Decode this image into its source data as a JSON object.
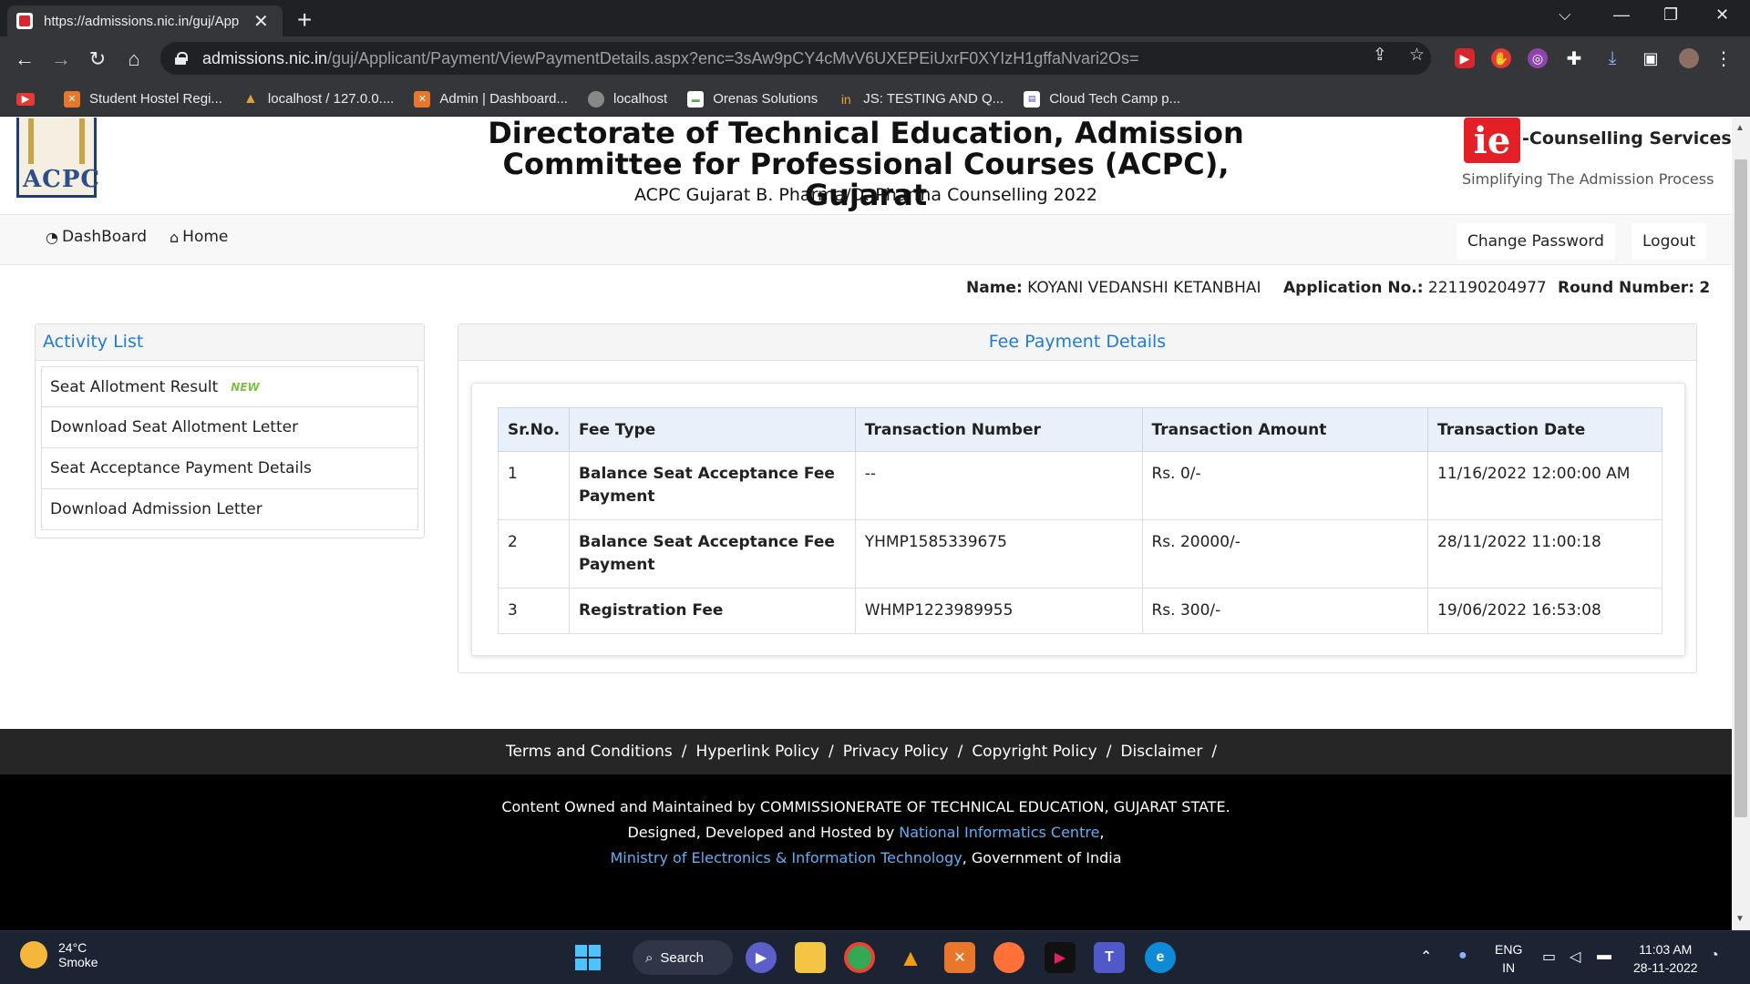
{
  "browser": {
    "tab_title": "https://admissions.nic.in/guj/App",
    "url_host": "admissions.nic.in",
    "url_path": "/guj/Applicant/Payment/ViewPaymentDetails.aspx?enc=3sAw9pCY4cMvV6UXEPEiUxrF0XYIzH1gffaNvari2Os=",
    "bookmarks": [
      {
        "label": "Student Hostel Regi...",
        "color": "#e8762b"
      },
      {
        "label": "localhost / 127.0.0....",
        "color": "#e0a040"
      },
      {
        "label": "Admin | Dashboard...",
        "color": "#e8762b"
      },
      {
        "label": "localhost",
        "color": "#888888"
      },
      {
        "label": "Orenas Solutions",
        "color": "#4caf50"
      },
      {
        "label": "JS: TESTING AND Q...",
        "color": "#f0a030"
      },
      {
        "label": "Cloud Tech Camp p...",
        "color": "#3f51b5"
      }
    ]
  },
  "header": {
    "logo_text": "ACPC",
    "title_line1": "Directorate of Technical Education, Admission",
    "title_line2": "Committee for Professional Courses (ACPC), Gujarat",
    "subtitle": "ACPC Gujarat B. Pharma/D. Pharma Counselling 2022",
    "brand_icon": "ie",
    "brand_name": "-Counselling Services",
    "brand_tagline": "Simplifying The Admission Process"
  },
  "navbar": {
    "dashboard": "DashBoard",
    "home": "Home",
    "change_password": "Change Password",
    "logout": "Logout"
  },
  "user": {
    "name_label": "Name:",
    "name_value": "KOYANI VEDANSHI KETANBHAI",
    "app_label": "Application No.:",
    "app_value": "221190204977",
    "round_label": "Round Number:",
    "round_value": "2"
  },
  "activity": {
    "title": "Activity List",
    "new_badge": "NEW",
    "items": [
      "Seat Allotment Result",
      "Download Seat Allotment Letter",
      "Seat Acceptance Payment Details",
      "Download Admission Letter"
    ]
  },
  "fee": {
    "title": "Fee Payment Details",
    "columns": [
      "Sr.No.",
      "Fee Type",
      "Transaction Number",
      "Transaction Amount",
      "Transaction Date"
    ],
    "rows": [
      [
        "1",
        "Balance Seat Acceptance Fee Payment",
        "--",
        "Rs. 0/-",
        "11/16/2022 12:00:00 AM"
      ],
      [
        "2",
        "Balance Seat Acceptance Fee Payment",
        "YHMP1585339675",
        "Rs. 20000/-",
        "28/11/2022 11:00:18"
      ],
      [
        "3",
        "Registration Fee",
        "WHMP1223989955",
        "Rs. 300/-",
        "19/06/2022 16:53:08"
      ]
    ]
  },
  "footer": {
    "links": [
      "Terms and Conditions",
      "Hyperlink Policy",
      "Privacy Policy",
      "Copyright Policy",
      "Disclaimer"
    ],
    "separator": "/",
    "line1": "Content Owned and Maintained by COMMISSIONERATE OF TECHNICAL EDUCATION, GUJARAT STATE.",
    "line2_prefix": "Designed, Developed and Hosted by ",
    "line2_link": "National Informatics Centre",
    "line2_suffix": ",",
    "line3_link": "Ministry of Electronics & Information Technology",
    "line3_suffix": ", Government of India"
  },
  "taskbar": {
    "temperature": "24°C",
    "weather": "Smoke",
    "search": "Search",
    "lang1": "ENG",
    "lang2": "IN",
    "time": "11:03 AM",
    "date": "28-11-2022"
  }
}
